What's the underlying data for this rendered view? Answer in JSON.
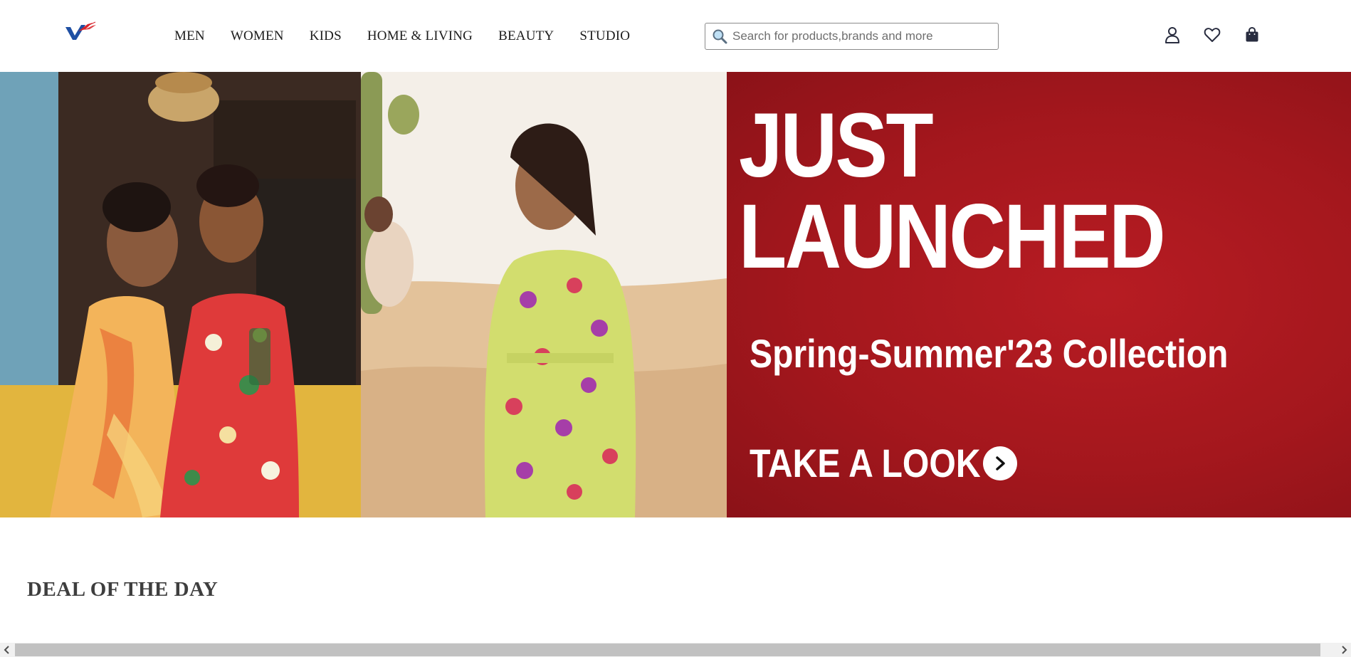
{
  "header": {
    "logo_alt": "V",
    "nav": [
      {
        "label": "MEN"
      },
      {
        "label": "WOMEN"
      },
      {
        "label": "KIDS"
      },
      {
        "label": "HOME & LIVING"
      },
      {
        "label": "BEAUTY"
      },
      {
        "label": "STUDIO"
      }
    ],
    "search": {
      "placeholder": "Search for products,brands and more",
      "value": ""
    },
    "icons": {
      "profile": "user-icon",
      "wishlist": "heart-icon",
      "bag": "shopping-bag-icon"
    }
  },
  "hero": {
    "headline_line1": "JUST",
    "headline_line2": "LAUNCHED",
    "subtitle": "Spring-Summer'23 Collection",
    "cta_label": "TAKE A LOOK",
    "cta_icon": "chevron-right-icon",
    "colors": {
      "promo_bg": "#a4171d",
      "text": "#ffffff"
    }
  },
  "deal_section": {
    "title": "DEAL OF THE DAY"
  },
  "colors": {
    "brand_blue": "#1f4fa3",
    "brand_red": "#d8232a"
  }
}
